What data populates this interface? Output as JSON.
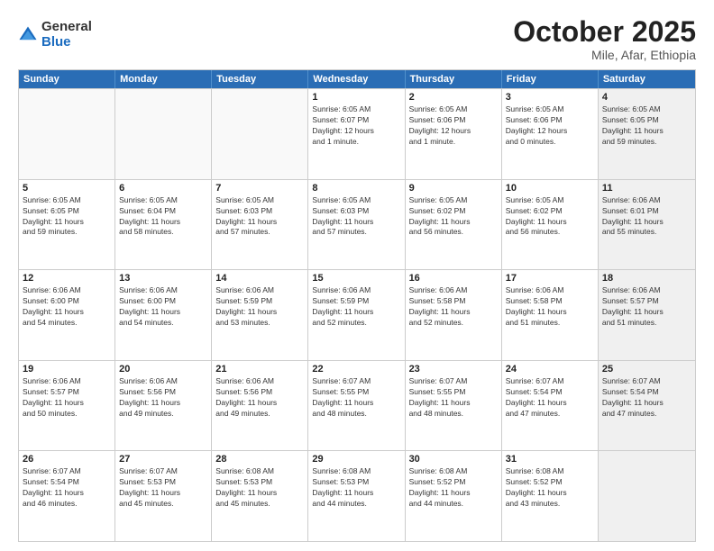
{
  "logo": {
    "general": "General",
    "blue": "Blue"
  },
  "header": {
    "month": "October 2025",
    "location": "Mile, Afar, Ethiopia"
  },
  "days": [
    "Sunday",
    "Monday",
    "Tuesday",
    "Wednesday",
    "Thursday",
    "Friday",
    "Saturday"
  ],
  "rows": [
    [
      {
        "day": "",
        "text": "",
        "empty": true
      },
      {
        "day": "",
        "text": "",
        "empty": true
      },
      {
        "day": "",
        "text": "",
        "empty": true
      },
      {
        "day": "1",
        "text": "Sunrise: 6:05 AM\nSunset: 6:07 PM\nDaylight: 12 hours\nand 1 minute.",
        "empty": false
      },
      {
        "day": "2",
        "text": "Sunrise: 6:05 AM\nSunset: 6:06 PM\nDaylight: 12 hours\nand 1 minute.",
        "empty": false
      },
      {
        "day": "3",
        "text": "Sunrise: 6:05 AM\nSunset: 6:06 PM\nDaylight: 12 hours\nand 0 minutes.",
        "empty": false
      },
      {
        "day": "4",
        "text": "Sunrise: 6:05 AM\nSunset: 6:05 PM\nDaylight: 11 hours\nand 59 minutes.",
        "empty": false,
        "shaded": true
      }
    ],
    [
      {
        "day": "5",
        "text": "Sunrise: 6:05 AM\nSunset: 6:05 PM\nDaylight: 11 hours\nand 59 minutes.",
        "empty": false
      },
      {
        "day": "6",
        "text": "Sunrise: 6:05 AM\nSunset: 6:04 PM\nDaylight: 11 hours\nand 58 minutes.",
        "empty": false
      },
      {
        "day": "7",
        "text": "Sunrise: 6:05 AM\nSunset: 6:03 PM\nDaylight: 11 hours\nand 57 minutes.",
        "empty": false
      },
      {
        "day": "8",
        "text": "Sunrise: 6:05 AM\nSunset: 6:03 PM\nDaylight: 11 hours\nand 57 minutes.",
        "empty": false
      },
      {
        "day": "9",
        "text": "Sunrise: 6:05 AM\nSunset: 6:02 PM\nDaylight: 11 hours\nand 56 minutes.",
        "empty": false
      },
      {
        "day": "10",
        "text": "Sunrise: 6:05 AM\nSunset: 6:02 PM\nDaylight: 11 hours\nand 56 minutes.",
        "empty": false
      },
      {
        "day": "11",
        "text": "Sunrise: 6:06 AM\nSunset: 6:01 PM\nDaylight: 11 hours\nand 55 minutes.",
        "empty": false,
        "shaded": true
      }
    ],
    [
      {
        "day": "12",
        "text": "Sunrise: 6:06 AM\nSunset: 6:00 PM\nDaylight: 11 hours\nand 54 minutes.",
        "empty": false
      },
      {
        "day": "13",
        "text": "Sunrise: 6:06 AM\nSunset: 6:00 PM\nDaylight: 11 hours\nand 54 minutes.",
        "empty": false
      },
      {
        "day": "14",
        "text": "Sunrise: 6:06 AM\nSunset: 5:59 PM\nDaylight: 11 hours\nand 53 minutes.",
        "empty": false
      },
      {
        "day": "15",
        "text": "Sunrise: 6:06 AM\nSunset: 5:59 PM\nDaylight: 11 hours\nand 52 minutes.",
        "empty": false
      },
      {
        "day": "16",
        "text": "Sunrise: 6:06 AM\nSunset: 5:58 PM\nDaylight: 11 hours\nand 52 minutes.",
        "empty": false
      },
      {
        "day": "17",
        "text": "Sunrise: 6:06 AM\nSunset: 5:58 PM\nDaylight: 11 hours\nand 51 minutes.",
        "empty": false
      },
      {
        "day": "18",
        "text": "Sunrise: 6:06 AM\nSunset: 5:57 PM\nDaylight: 11 hours\nand 51 minutes.",
        "empty": false,
        "shaded": true
      }
    ],
    [
      {
        "day": "19",
        "text": "Sunrise: 6:06 AM\nSunset: 5:57 PM\nDaylight: 11 hours\nand 50 minutes.",
        "empty": false
      },
      {
        "day": "20",
        "text": "Sunrise: 6:06 AM\nSunset: 5:56 PM\nDaylight: 11 hours\nand 49 minutes.",
        "empty": false
      },
      {
        "day": "21",
        "text": "Sunrise: 6:06 AM\nSunset: 5:56 PM\nDaylight: 11 hours\nand 49 minutes.",
        "empty": false
      },
      {
        "day": "22",
        "text": "Sunrise: 6:07 AM\nSunset: 5:55 PM\nDaylight: 11 hours\nand 48 minutes.",
        "empty": false
      },
      {
        "day": "23",
        "text": "Sunrise: 6:07 AM\nSunset: 5:55 PM\nDaylight: 11 hours\nand 48 minutes.",
        "empty": false
      },
      {
        "day": "24",
        "text": "Sunrise: 6:07 AM\nSunset: 5:54 PM\nDaylight: 11 hours\nand 47 minutes.",
        "empty": false
      },
      {
        "day": "25",
        "text": "Sunrise: 6:07 AM\nSunset: 5:54 PM\nDaylight: 11 hours\nand 47 minutes.",
        "empty": false,
        "shaded": true
      }
    ],
    [
      {
        "day": "26",
        "text": "Sunrise: 6:07 AM\nSunset: 5:54 PM\nDaylight: 11 hours\nand 46 minutes.",
        "empty": false
      },
      {
        "day": "27",
        "text": "Sunrise: 6:07 AM\nSunset: 5:53 PM\nDaylight: 11 hours\nand 45 minutes.",
        "empty": false
      },
      {
        "day": "28",
        "text": "Sunrise: 6:08 AM\nSunset: 5:53 PM\nDaylight: 11 hours\nand 45 minutes.",
        "empty": false
      },
      {
        "day": "29",
        "text": "Sunrise: 6:08 AM\nSunset: 5:53 PM\nDaylight: 11 hours\nand 44 minutes.",
        "empty": false
      },
      {
        "day": "30",
        "text": "Sunrise: 6:08 AM\nSunset: 5:52 PM\nDaylight: 11 hours\nand 44 minutes.",
        "empty": false
      },
      {
        "day": "31",
        "text": "Sunrise: 6:08 AM\nSunset: 5:52 PM\nDaylight: 11 hours\nand 43 minutes.",
        "empty": false
      },
      {
        "day": "",
        "text": "",
        "empty": true,
        "shaded": true
      }
    ]
  ]
}
